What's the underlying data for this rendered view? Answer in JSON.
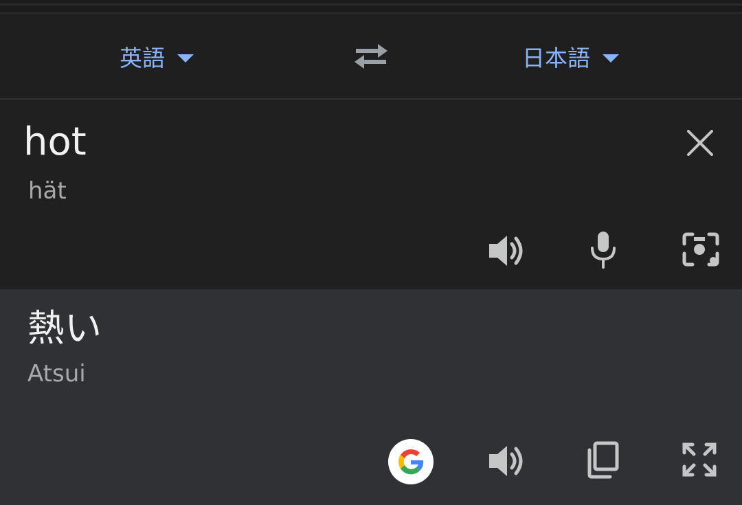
{
  "languages": {
    "source": "英語",
    "target": "日本語"
  },
  "input": {
    "text": "hot",
    "transliteration": "hät"
  },
  "output": {
    "text": "熱い",
    "transliteration": "Atsui"
  },
  "icons": {
    "swap": "swap-arrows-icon",
    "clear": "close-icon",
    "listen_source": "speaker-icon",
    "mic": "microphone-icon",
    "camera": "camera-icon",
    "google": "google-logo-icon",
    "listen_target": "speaker-icon",
    "copy": "copy-icon",
    "fullscreen": "fullscreen-icon"
  },
  "colors": {
    "accent": "#8ab4f8",
    "input_bg": "#202020",
    "output_bg": "#303134",
    "icon": "#c4c7c5"
  }
}
